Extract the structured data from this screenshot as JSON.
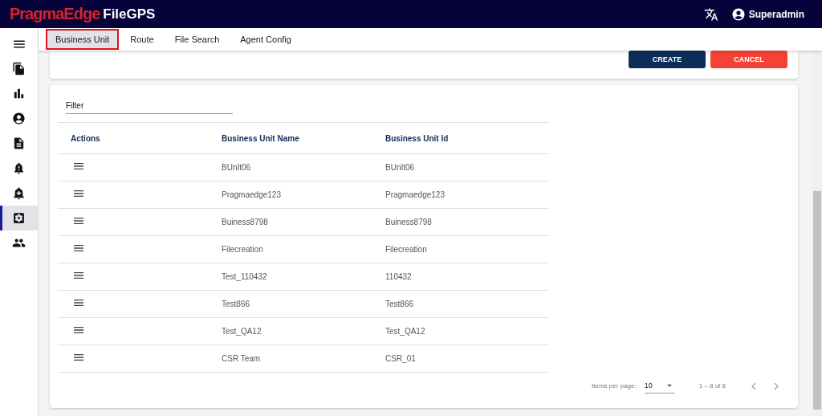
{
  "header": {
    "brand": "PragmaEdge",
    "product": "FileGPS",
    "user": "Superadmin"
  },
  "sidebar": {
    "items": [
      {
        "selected": false
      },
      {
        "selected": false
      },
      {
        "selected": false
      },
      {
        "selected": false
      },
      {
        "selected": false
      },
      {
        "selected": false
      },
      {
        "selected": true
      },
      {
        "selected": false
      }
    ]
  },
  "tabs": [
    {
      "label": "Business Unit",
      "selected": true
    },
    {
      "label": "Route",
      "selected": false
    },
    {
      "label": "File Search",
      "selected": false
    },
    {
      "label": "Agent Config",
      "selected": false
    }
  ],
  "buttons": [
    {
      "label": "CREATE",
      "kind": "primary"
    },
    {
      "label": "CANCEL",
      "kind": "danger"
    }
  ],
  "filter": {
    "placeholder": "Filter"
  },
  "table": {
    "columns": [
      "Actions",
      "Business Unit Name",
      "Business Unit Id"
    ],
    "rows": [
      {
        "name": "BUnIt06",
        "id": "BUnIt06"
      },
      {
        "name": "Pragmaedge123",
        "id": "Pragmaedge123"
      },
      {
        "name": "Buiness8798",
        "id": "Buiness8798"
      },
      {
        "name": "Filecreation",
        "id": "Filecreation"
      },
      {
        "name": "Test_110432",
        "id": "110432"
      },
      {
        "name": "Test866",
        "id": "Test866"
      },
      {
        "name": "Test_QA12",
        "id": "Test_QA12"
      },
      {
        "name": "CSR Team",
        "id": "CSR_01"
      }
    ]
  },
  "paginator": {
    "label": "Items per page:",
    "page_size": "10",
    "range": "1 – 8 of 8"
  }
}
